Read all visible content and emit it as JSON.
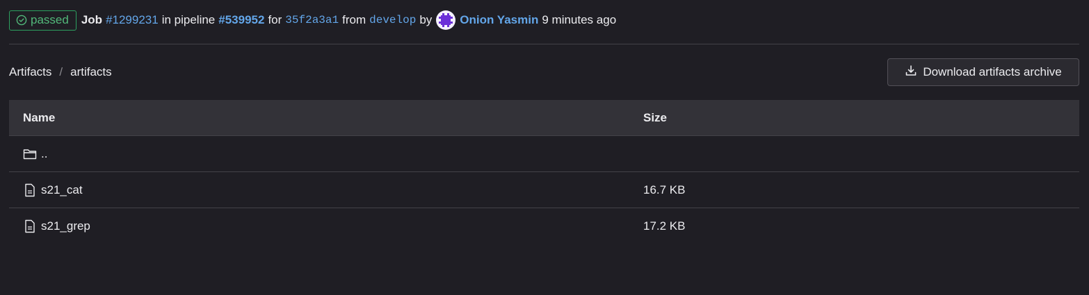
{
  "header": {
    "status": "passed",
    "job_word": "Job",
    "job_id": "#1299231",
    "in_pipeline": "in pipeline",
    "pipeline_id": "#539952",
    "for_word": "for",
    "commit_sha": "35f2a3a1",
    "from_word": "from",
    "branch": "develop",
    "by_word": "by",
    "user_name": "Onion Yasmin",
    "time_ago": "9 minutes ago"
  },
  "breadcrumb": {
    "root": "Artifacts",
    "separator": "/",
    "current": "artifacts"
  },
  "actions": {
    "download_label": "Download artifacts archive"
  },
  "table": {
    "columns": [
      "Name",
      "Size"
    ],
    "rows": [
      {
        "icon": "folder-icon",
        "name": "..",
        "size": ""
      },
      {
        "icon": "file-icon",
        "name": "s21_cat",
        "size": "16.7 KB"
      },
      {
        "icon": "file-icon",
        "name": "s21_grep",
        "size": "17.2 KB"
      }
    ]
  },
  "colors": {
    "background": "#1f1e24",
    "success": "#52b87a",
    "link": "#63a6e9",
    "header_row": "#333238"
  }
}
